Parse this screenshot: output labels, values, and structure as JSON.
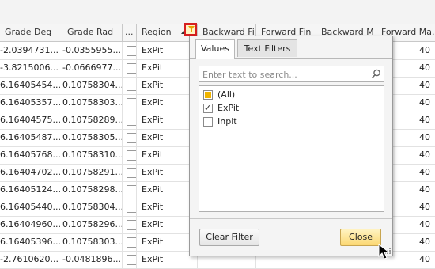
{
  "grid": {
    "columns": [
      "Grade Deg",
      "Grade Rad",
      "...",
      "Region",
      "Backward Fi",
      "Forward Fin",
      "Backward M",
      "Forward Ma..."
    ],
    "rows": [
      [
        "-2.0394731...",
        "-0.0355955...",
        "ExPit",
        "40"
      ],
      [
        "-3.8215006...",
        "-0.0666977...",
        "ExPit",
        "40"
      ],
      [
        "6.16405454...",
        "0.10758304...",
        "ExPit",
        "40"
      ],
      [
        "6.16405357...",
        "0.10758303...",
        "ExPit",
        "40"
      ],
      [
        "6.16404575...",
        "0.10758289...",
        "ExPit",
        "40"
      ],
      [
        "6.16405487...",
        "0.10758305...",
        "ExPit",
        "40"
      ],
      [
        "6.16405768...",
        "0.10758310...",
        "ExPit",
        "40"
      ],
      [
        "6.16404702...",
        "0.10758291...",
        "ExPit",
        "40"
      ],
      [
        "6.16405124...",
        "0.10758298...",
        "ExPit",
        "40"
      ],
      [
        "6.16405440...",
        "0.10758304...",
        "ExPit",
        "40"
      ],
      [
        "6.16404960...",
        "0.10758296...",
        "ExPit",
        "40"
      ],
      [
        "6.16405396...",
        "0.10758303...",
        "ExPit",
        "40"
      ],
      [
        "-2.7610620...",
        "-0.0481896...",
        "ExPit",
        "40"
      ]
    ]
  },
  "filter_popup": {
    "tabs": [
      "Values",
      "Text Filters"
    ],
    "active_tab": "Values",
    "search_placeholder": "Enter text to search...",
    "items": [
      {
        "label": "(All)",
        "state": "indeterminate"
      },
      {
        "label": "ExPit",
        "state": "checked"
      },
      {
        "label": "Inpit",
        "state": "unchecked"
      }
    ],
    "clear_label": "Clear Filter",
    "close_label": "Close"
  },
  "icons": {
    "filter": "filter-funnel-icon",
    "search": "magnifier-icon",
    "sort": "sort-ascending-icon"
  },
  "colors": {
    "filter_highlight": "#d61f1f",
    "funnel": "#e9a100",
    "close_button": "#fbd873"
  }
}
